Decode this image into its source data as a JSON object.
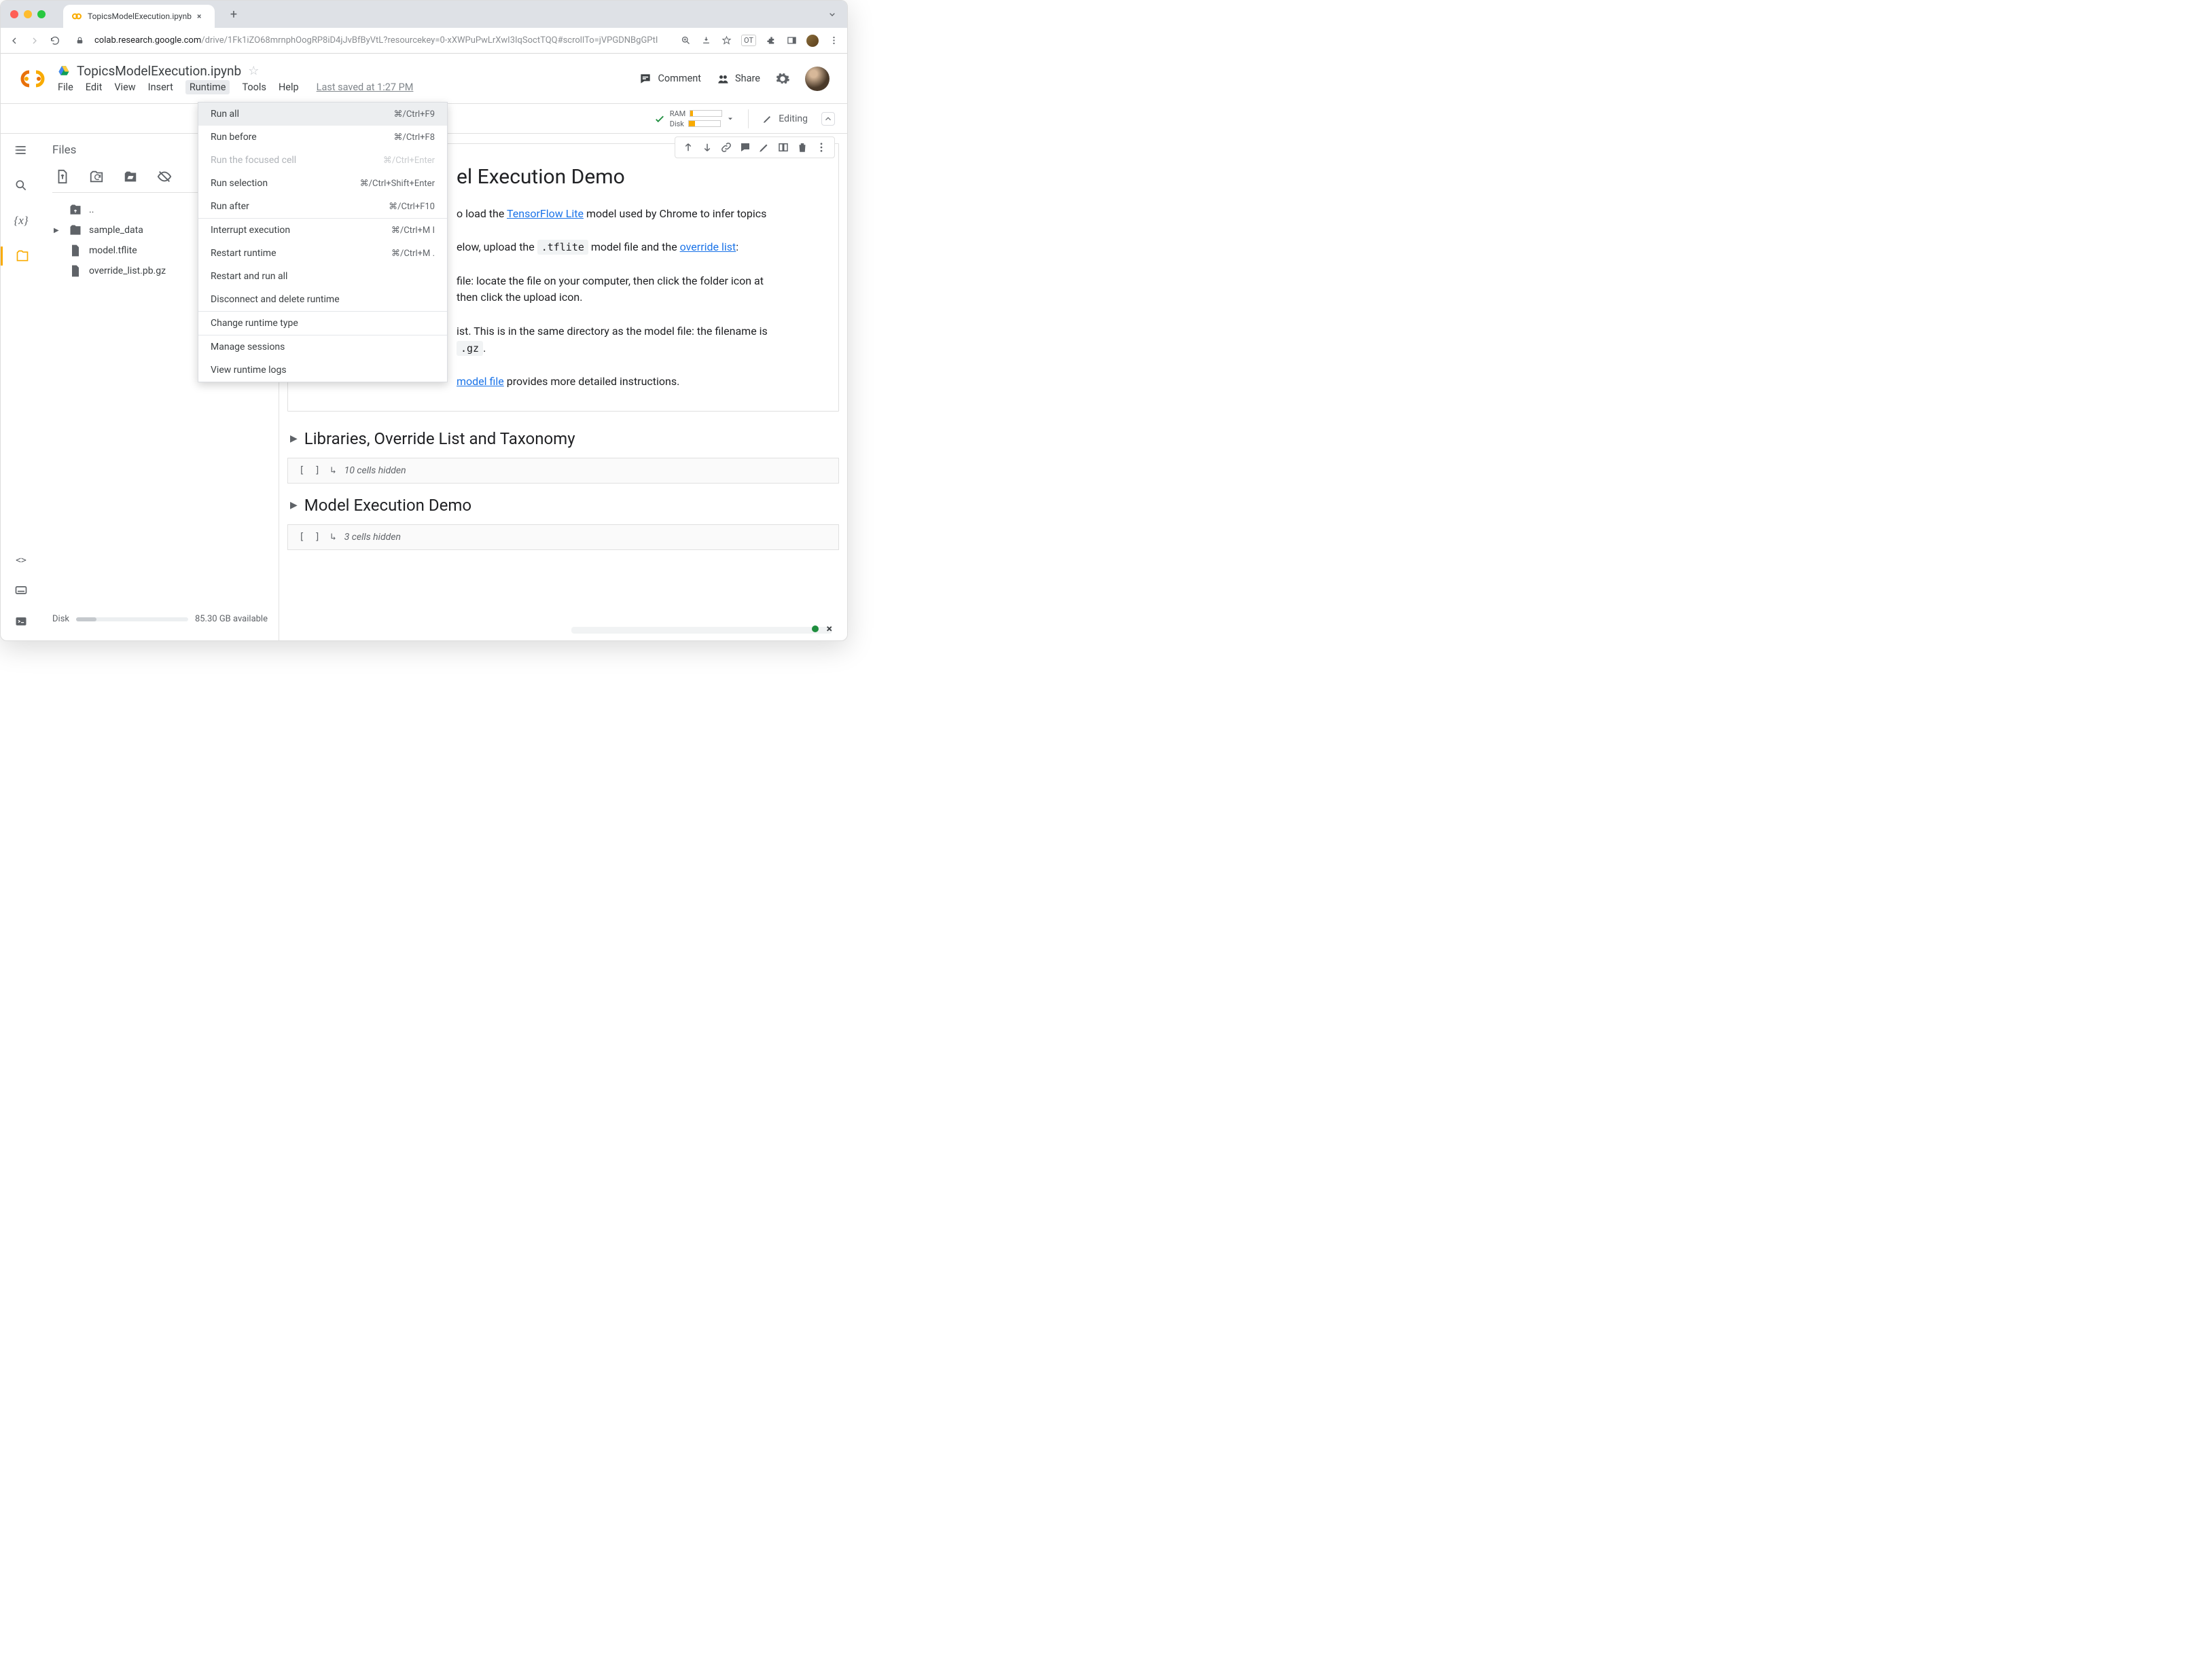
{
  "browser": {
    "tab_title": "TopicsModelExecution.ipynb",
    "url_host": "colab.research.google.com",
    "url_path": "/drive/1Fk1iZO68mrnphOogRP8iD4jJvBfByVtL?resourcekey=0-xXWPuPwLrXwI3IqSoctTQQ#scrollTo=jVPGDNBgGPtI",
    "ot_badge": "OT"
  },
  "header": {
    "title": "TopicsModelExecution.ipynb",
    "menus": [
      "File",
      "Edit",
      "View",
      "Insert",
      "Runtime",
      "Tools",
      "Help"
    ],
    "menu_selected": 4,
    "last_saved": "Last saved at 1:27 PM",
    "comment": "Comment",
    "share": "Share"
  },
  "toolbar": {
    "ram_label": "RAM",
    "disk_label": "Disk",
    "ram_pct": 8,
    "disk_pct": 20,
    "editing": "Editing"
  },
  "files_panel": {
    "title": "Files",
    "tree": {
      "up": "..",
      "folder": "sample_data",
      "file1": "model.tflite",
      "file2": "override_list.pb.gz"
    },
    "disk_label": "Disk",
    "disk_avail": "85.30 GB available"
  },
  "runtime_menu": {
    "items": [
      {
        "label": "Run all",
        "shortcut": "⌘/Ctrl+F9",
        "state": "hover"
      },
      {
        "label": "Run before",
        "shortcut": "⌘/Ctrl+F8"
      },
      {
        "label": "Run the focused cell",
        "shortcut": "⌘/Ctrl+Enter",
        "state": "disabled"
      },
      {
        "label": "Run selection",
        "shortcut": "⌘/Ctrl+Shift+Enter"
      },
      {
        "label": "Run after",
        "shortcut": "⌘/Ctrl+F10"
      },
      {
        "sep": true
      },
      {
        "label": "Interrupt execution",
        "shortcut": "⌘/Ctrl+M I"
      },
      {
        "label": "Restart runtime",
        "shortcut": "⌘/Ctrl+M ."
      },
      {
        "label": "Restart and run all"
      },
      {
        "label": "Disconnect and delete runtime"
      },
      {
        "sep": true
      },
      {
        "label": "Change runtime type"
      },
      {
        "sep": true
      },
      {
        "label": "Manage sessions"
      },
      {
        "label": "View runtime logs"
      }
    ]
  },
  "notebook": {
    "h1_suffix": "el Execution Demo",
    "p1_a": "o load the ",
    "p1_link": "TensorFlow Lite",
    "p1_b": " model used by Chrome to infer topics",
    "p2_a": "elow, upload the ",
    "p2_code": ".tflite",
    "p2_b": " model file and the ",
    "p2_link": "override list",
    "p2_c": ":",
    "li1_a": " file: locate the file on your computer, then click the folder icon at",
    "li1_b": " then click the upload icon.",
    "li2_a": "ist. This is in the same directory as the model file: the filename is",
    "li2_code": ".gz",
    "li2_b": ".",
    "p3_link": "model file",
    "p3_b": " provides more detailed instructions.",
    "section1": "Libraries, Override List and Taxonomy",
    "hidden1": "10 cells hidden",
    "section2": "Model Execution Demo",
    "hidden2": "3 cells hidden",
    "brackets": "[  ]",
    "sub": "↳"
  }
}
